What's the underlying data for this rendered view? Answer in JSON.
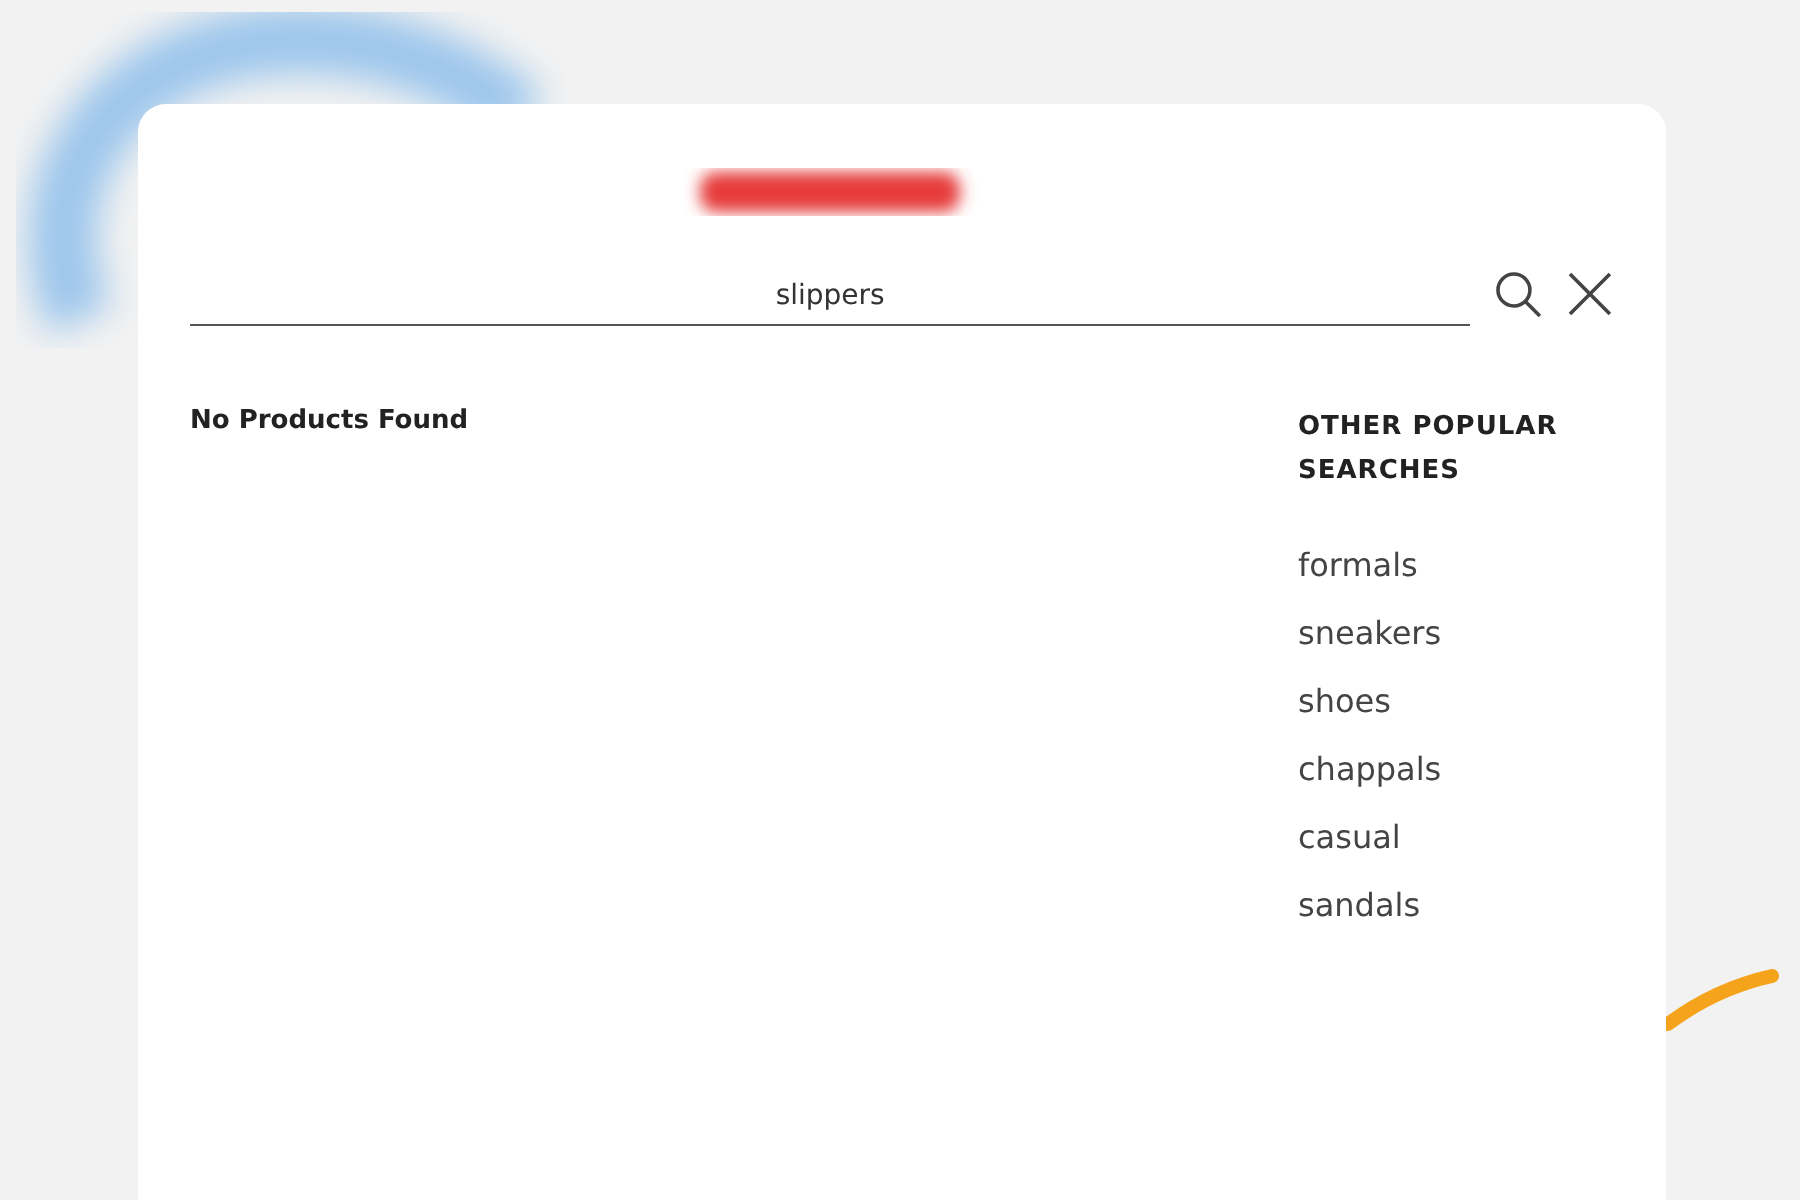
{
  "search": {
    "value": "slippers"
  },
  "results": {
    "message": "No Products Found"
  },
  "popular": {
    "heading": "OTHER POPULAR SEARCHES",
    "items": [
      "formals",
      "sneakers",
      "shoes",
      "chappals",
      "casual",
      "sandals"
    ]
  }
}
